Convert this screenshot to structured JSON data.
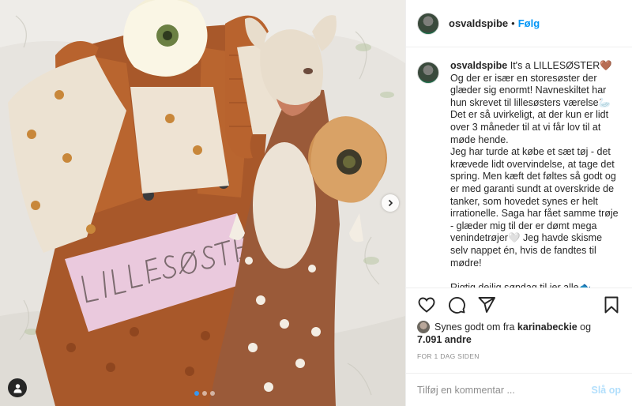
{
  "photo": {
    "name_sign_text": "LILLESØSTER",
    "carousel_dots": 3,
    "active_dot": 0
  },
  "header": {
    "username": "osvaldspibe",
    "separator": "•",
    "follow_label": "Følg",
    "more_label": "•••"
  },
  "caption": {
    "username": "osvaldspibe",
    "text": "It's a LILLESØSTER🤎\nOg der er især en storesøster der glæder sig enormt! Navneskiltet har hun skrevet til lillesøsters værelse🦢\nDet er så uvirkeligt, at der kun er lidt over 3 måneder til at vi får lov til at møde hende.\nJeg har turde at købe et sæt tøj - det krævede lidt overvindelse, at tage det spring. Men kæft det føltes så godt og er med garanti sundt at overskride de tanker, som hovedet synes er helt irrationelle. Saga har fået samme trøje - glæder mig til der er dømt mega venindetrøjer🤍 Jeg havde skisme selv nappet én, hvis de fandtes til mødre!\n\nRigtig dejlig søndag til jer alle🐟"
  },
  "actions": {
    "like_icon": "heart-icon",
    "comment_icon": "comment-icon",
    "share_icon": "paper-plane-icon",
    "save_icon": "bookmark-icon"
  },
  "likes": {
    "prefix": "Synes godt om fra ",
    "user": "karinabeckie",
    "joiner": " og",
    "count_text": "7.091 andre"
  },
  "timestamp": "FOR 1 DAG SIDEN",
  "comment_box": {
    "placeholder": "Tilføj en kommentar ...",
    "post_label": "Slå op"
  },
  "colors": {
    "follow_blue": "#0095f6",
    "post_disabled": "#b2dffc",
    "muted": "#8e8e8e",
    "text": "#262626"
  }
}
